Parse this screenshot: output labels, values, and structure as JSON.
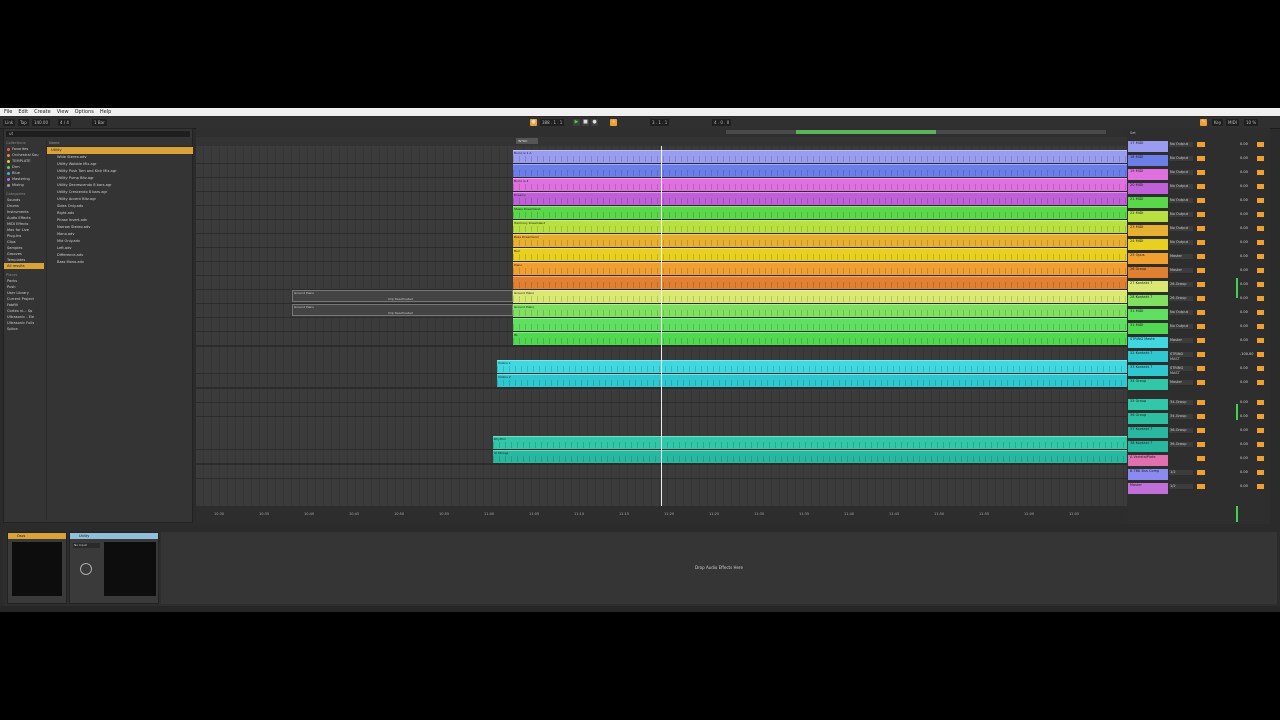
{
  "menu": [
    "File",
    "Edit",
    "Create",
    "View",
    "Options",
    "Help"
  ],
  "transport": {
    "link": "Link",
    "tap": "Tap",
    "tempo": "140.00",
    "sig": "4 / 4",
    "quant": "1 Bar",
    "pos1": "388 . 1 . 1",
    "pos2": "3 . 1 . 1",
    "pos3": "4 . 0 . 0",
    "key": "Key",
    "zoom": "MIDI",
    "cpu": "10 %"
  },
  "browser": {
    "search": "ut",
    "collections_header": "Collections",
    "collections": [
      {
        "label": "Favorites",
        "color": "#e55a4a"
      },
      {
        "label": "Orchestral Sou",
        "color": "#e58a3a"
      },
      {
        "label": "TEMPLATE",
        "color": "#e5c93a"
      },
      {
        "label": "Drm",
        "color": "#5ad05a"
      },
      {
        "label": "Blue",
        "color": "#4aa5e5"
      },
      {
        "label": "Mastering",
        "color": "#b56ae5"
      },
      {
        "label": "Mixing",
        "color": "#9a9a9a"
      }
    ],
    "categories_header": "Categories",
    "categories": [
      "Sounds",
      "Drums",
      "Instruments",
      "Audio Effects",
      "MIDI Effects",
      "Max for Live",
      "Plug-Ins",
      "Clips",
      "Samples",
      "Grooves",
      "Templates",
      "All results"
    ],
    "places_header": "Places",
    "places": [
      "Packs",
      "Push",
      "User Library",
      "Current Project",
      "Fabfilt",
      "Cortex vl... Sp",
      "Ultrasonic - Ele",
      "Ultrasonic Fulls",
      "Splice"
    ],
    "name_header": "Name",
    "folder": "Utility",
    "files": [
      "Wide Stereo.adv",
      "Utility Wobble Mix.agr",
      "Utility Push Tom and Kick Mix.agr",
      "Utility Pump Bitz.agr",
      "Utility Decrescendo 8 bars.agr",
      "Utility Crescendo 8 bars.agr",
      "Utility Accent Bitz.agr",
      "Sides Only.adv",
      "Right.adv",
      "Phase Invert.adv",
      "Narrow Stereo.adv",
      "Mono.adv",
      "Mid Only.adv",
      "Left.adv",
      "Difference.adv",
      "Bass Mono.adv"
    ]
  },
  "arrangement": {
    "locator": "INTRO",
    "clips": [
      {
        "label": "Bocio is 1 A",
        "color": "#9a9cf0"
      },
      {
        "label": "",
        "color": "#6c7ee8"
      },
      {
        "label": "Bocio is 2",
        "color": "#e070e0"
      },
      {
        "label": "Dreamy",
        "color": "#c060d8"
      },
      {
        "label": "Stasis Dreamland",
        "color": "#5ad84a"
      },
      {
        "label": "Harmony Dreamland",
        "color": "#b8e040"
      },
      {
        "label": "Bass Dreamland",
        "color": "#e8b030"
      },
      {
        "label": "Bell",
        "color": "#e8d020"
      },
      {
        "label": "Piano",
        "color": "#f0a030"
      },
      {
        "label": "",
        "color": "#e08030"
      },
      {
        "label": "Ground Piano",
        "color": "#d8e870"
      },
      {
        "label": "Ground Piano",
        "color": "#80e060"
      },
      {
        "label": "",
        "color": "#60e060"
      },
      {
        "label": "HL",
        "color": "#50d850"
      },
      {
        "label": "Violins 1",
        "color": "#40d8e0"
      },
      {
        "label": "Violins 2",
        "color": "#30c8d0"
      },
      {
        "label": "Rhythm",
        "color": "#30c8a8"
      },
      {
        "label": "Vl Strings",
        "color": "#28b8a0"
      }
    ],
    "ghost_a": "Ground Piano",
    "ghost_b": "Ground Piano",
    "ghost_note": "Clip Deactivated",
    "times": [
      "10:30",
      "10:35",
      "10:40",
      "10:45",
      "10:50",
      "10:55",
      "11:00",
      "11:05",
      "11:10",
      "11:15",
      "11:20",
      "11:25",
      "11:30",
      "11:35",
      "11:40",
      "11:45",
      "11:50",
      "11:55",
      "12:00",
      "12:05"
    ]
  },
  "mixer": {
    "set_label": "Set",
    "tracks": [
      {
        "name": "17 MIDI",
        "color": "#9a9cf0",
        "out": "No Output",
        "vol": "0.00"
      },
      {
        "name": "18 MIDI",
        "color": "#6c7ee8",
        "out": "No Output",
        "vol": "0.00"
      },
      {
        "name": "19 MIDI",
        "color": "#e070e0",
        "out": "No Output",
        "vol": "0.00"
      },
      {
        "name": "20 MIDI",
        "color": "#c060d8",
        "out": "No Output",
        "vol": "0.00"
      },
      {
        "name": "21 MIDI",
        "color": "#5ad84a",
        "out": "No Output",
        "vol": "0.00"
      },
      {
        "name": "22 MIDI",
        "color": "#b8e040",
        "out": "No Output",
        "vol": "0.00"
      },
      {
        "name": "23 MIDI",
        "color": "#e8b030",
        "out": "No Output",
        "vol": "0.00"
      },
      {
        "name": "24 MIDI",
        "color": "#e8d020",
        "out": "No Output",
        "vol": "0.00"
      },
      {
        "name": "25 Opus",
        "color": "#f0a030",
        "out": "Master",
        "vol": "0.00"
      },
      {
        "name": "26 Group",
        "color": "#e08030",
        "out": "Master",
        "vol": "0.00"
      },
      {
        "name": "27 Kontakt 7",
        "color": "#d8e870",
        "out": "26-Group",
        "vol": "0.00"
      },
      {
        "name": "28 Kontakt 7",
        "color": "#80e060",
        "out": "26-Group",
        "vol": "0.00"
      },
      {
        "name": "31 MIDI",
        "color": "#60e060",
        "out": "No Output",
        "vol": "0.00"
      },
      {
        "name": "31 MIDI",
        "color": "#50d850",
        "out": "No Output",
        "vol": "0.00"
      },
      {
        "name": "STRING Maste",
        "color": "#40d8e0",
        "out": "Master",
        "vol": "0.00"
      },
      {
        "name": "32 Kontakt 7",
        "color": "#30c8d0",
        "out": "STRING MAST",
        "vol": "-100.00"
      },
      {
        "name": "33 Kontakt 7",
        "color": "#30c8d0",
        "out": "STRING MAST",
        "vol": "0.00"
      },
      {
        "name": "34 Group",
        "color": "#30c8a8",
        "out": "Master",
        "vol": "0.00"
      },
      {
        "name": "35 Group",
        "color": "#30c8a8",
        "out": "34-Group",
        "vol": "0.00"
      },
      {
        "name": "36 Group",
        "color": "#2cc0a0",
        "out": "34-Group",
        "vol": "0.00"
      },
      {
        "name": "37 Kontakt 7",
        "color": "#28b8a0",
        "out": "36-Group",
        "vol": "0.00"
      },
      {
        "name": "38 Kontakt 7",
        "color": "#28b8a0",
        "out": "36-Group",
        "vol": "0.00"
      },
      {
        "name": "A VarietalPlate",
        "color": "#e070b0",
        "out": "",
        "vol": "0.00"
      },
      {
        "name": "B TBK Bus Comp",
        "color": "#8a8af0",
        "out": "1/2",
        "vol": "0.00"
      },
      {
        "name": "Master",
        "color": "#c070d8",
        "out": "1/2",
        "vol": "0.00"
      }
    ]
  },
  "devices": {
    "dev1": "Oscs",
    "dev2": "Utility",
    "dev2_sub": "No Input",
    "drop_hint": "Drop Audio Effects Here"
  }
}
